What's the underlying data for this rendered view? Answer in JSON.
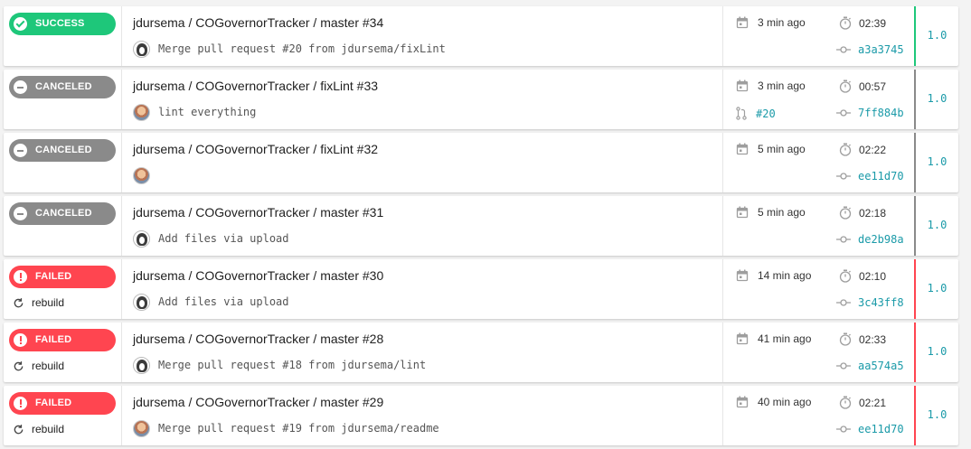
{
  "builds": [
    {
      "status": "success",
      "status_label": "SUCCESS",
      "rebuild": "",
      "title": "jdursema / COGovernorTracker / master #34",
      "avatar": "dark",
      "message": "Merge pull request #20 from jdursema/fixLint",
      "time": "3 min ago",
      "duration": "02:39",
      "pr": "",
      "sha": "a3a3745",
      "tag": "1.0"
    },
    {
      "status": "canceled",
      "status_label": "CANCELED",
      "rebuild": "",
      "title": "jdursema / COGovernorTracker / fixLint #33",
      "avatar": "photo",
      "message": "lint everything",
      "time": "3 min ago",
      "duration": "00:57",
      "pr": "#20",
      "sha": "7ff884b",
      "tag": "1.0"
    },
    {
      "status": "canceled",
      "status_label": "CANCELED",
      "rebuild": "",
      "title": "jdursema / COGovernorTracker / fixLint #32",
      "avatar": "photo",
      "message": "",
      "time": "5 min ago",
      "duration": "02:22",
      "pr": "",
      "sha": "ee11d70",
      "tag": "1.0"
    },
    {
      "status": "canceled",
      "status_label": "CANCELED",
      "rebuild": "",
      "title": "jdursema / COGovernorTracker / master #31",
      "avatar": "dark",
      "message": "Add files via upload",
      "time": "5 min ago",
      "duration": "02:18",
      "pr": "",
      "sha": "de2b98a",
      "tag": "1.0"
    },
    {
      "status": "failed",
      "status_label": "FAILED",
      "rebuild": "rebuild",
      "title": "jdursema / COGovernorTracker / master #30",
      "avatar": "dark",
      "message": "Add files via upload",
      "time": "14 min ago",
      "duration": "02:10",
      "pr": "",
      "sha": "3c43ff8",
      "tag": "1.0"
    },
    {
      "status": "failed",
      "status_label": "FAILED",
      "rebuild": "rebuild",
      "title": "jdursema / COGovernorTracker / master #28",
      "avatar": "dark",
      "message": "Merge pull request #18 from jdursema/lint",
      "time": "41 min ago",
      "duration": "02:33",
      "pr": "",
      "sha": "aa574a5",
      "tag": "1.0"
    },
    {
      "status": "failed",
      "status_label": "FAILED",
      "rebuild": "rebuild",
      "title": "jdursema / COGovernorTracker / master #29",
      "avatar": "photo",
      "message": "Merge pull request #19 from jdursema/readme",
      "time": "40 min ago",
      "duration": "02:21",
      "pr": "",
      "sha": "ee11d70",
      "tag": "1.0"
    }
  ],
  "icons": {
    "success": "check-circle-icon",
    "canceled": "minus-circle-icon",
    "failed": "exclamation-circle-icon",
    "rebuild": "refresh-icon",
    "time": "calendar-icon",
    "duration": "stopwatch-icon",
    "pr": "pull-request-icon",
    "sha": "commit-icon"
  },
  "colors": {
    "success": "#1ec77a",
    "canceled": "#8a8a8a",
    "failed": "#ff4550",
    "link": "#1a9aa8"
  }
}
